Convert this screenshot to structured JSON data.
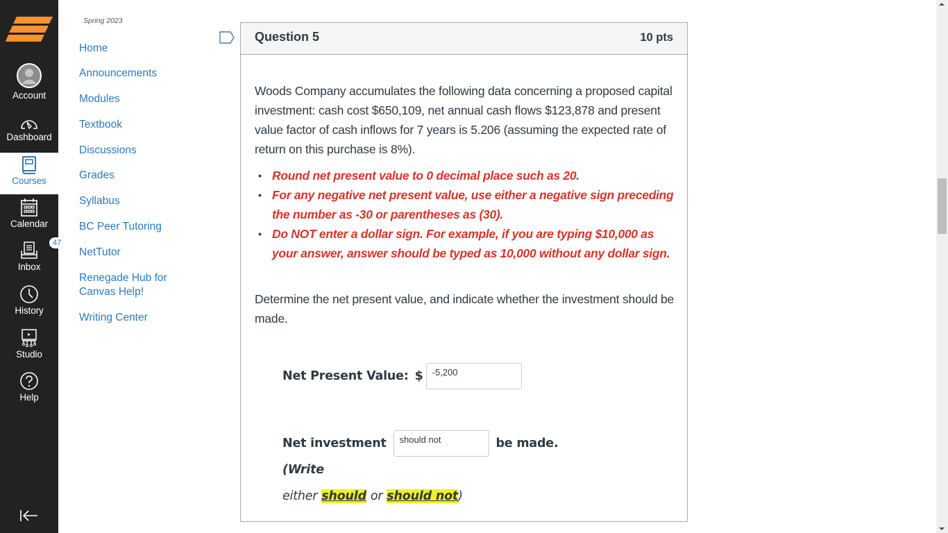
{
  "global_nav": {
    "items": [
      {
        "id": "account",
        "label": "Account",
        "icon": "avatar-icon",
        "active": false
      },
      {
        "id": "dashboard",
        "label": "Dashboard",
        "icon": "speedometer-icon",
        "active": false
      },
      {
        "id": "courses",
        "label": "Courses",
        "icon": "book-icon",
        "active": true
      },
      {
        "id": "calendar",
        "label": "Calendar",
        "icon": "calendar-icon",
        "active": false
      },
      {
        "id": "inbox",
        "label": "Inbox",
        "icon": "inbox-icon",
        "active": false,
        "badge": "47"
      },
      {
        "id": "history",
        "label": "History",
        "icon": "clock-icon",
        "active": false
      },
      {
        "id": "studio",
        "label": "Studio",
        "icon": "studio-icon",
        "active": false
      },
      {
        "id": "help",
        "label": "Help",
        "icon": "question-icon",
        "active": false
      }
    ],
    "colors": {
      "background": "#222222",
      "logo": "#f6922f",
      "active_text": "#2b7abc"
    }
  },
  "course_nav": {
    "term": "Spring 2023",
    "links": [
      {
        "label": "Home"
      },
      {
        "label": "Announcements"
      },
      {
        "label": "Modules"
      },
      {
        "label": "Textbook"
      },
      {
        "label": "Discussions"
      },
      {
        "label": "Grades"
      },
      {
        "label": "Syllabus"
      },
      {
        "label": "BC Peer Tutoring"
      },
      {
        "label": "NetTutor"
      },
      {
        "label": "Renegade Hub for Canvas Help!"
      },
      {
        "label": "Writing Center"
      }
    ]
  },
  "question": {
    "title": "Question 5",
    "points": "10 pts",
    "prompt": "Woods Company accumulates the following data concerning a proposed capital investment: cash cost $650,109, net annual cash flows $123,878 and present value factor of cash inflows for 7 years is 5.206 (assuming the expected rate of return on this purchase is 8%).",
    "notes": [
      "Round net present value to 0 decimal place such as 20.",
      "For any negative net present value, use either a negative sign preceding the number as -30 or parentheses as (30).",
      "Do NOT enter a dollar sign. For example, if you are typing $10,000 as your answer, answer should be typed as 10,000 without any dollar sign."
    ],
    "instruction": "Determine the net present value, and indicate whether the investment should be made.",
    "npv_label": "Net Present Value:",
    "npv_currency": "$",
    "npv_value": "-5,200",
    "investment_label": "Net investment",
    "investment_value": "should not",
    "investment_suffix": "be made.",
    "hint_open": "(Write",
    "hint_either": "either",
    "hint_option_1": "should",
    "hint_or": "or",
    "hint_option_2": "should not",
    "hint_close": ")"
  }
}
